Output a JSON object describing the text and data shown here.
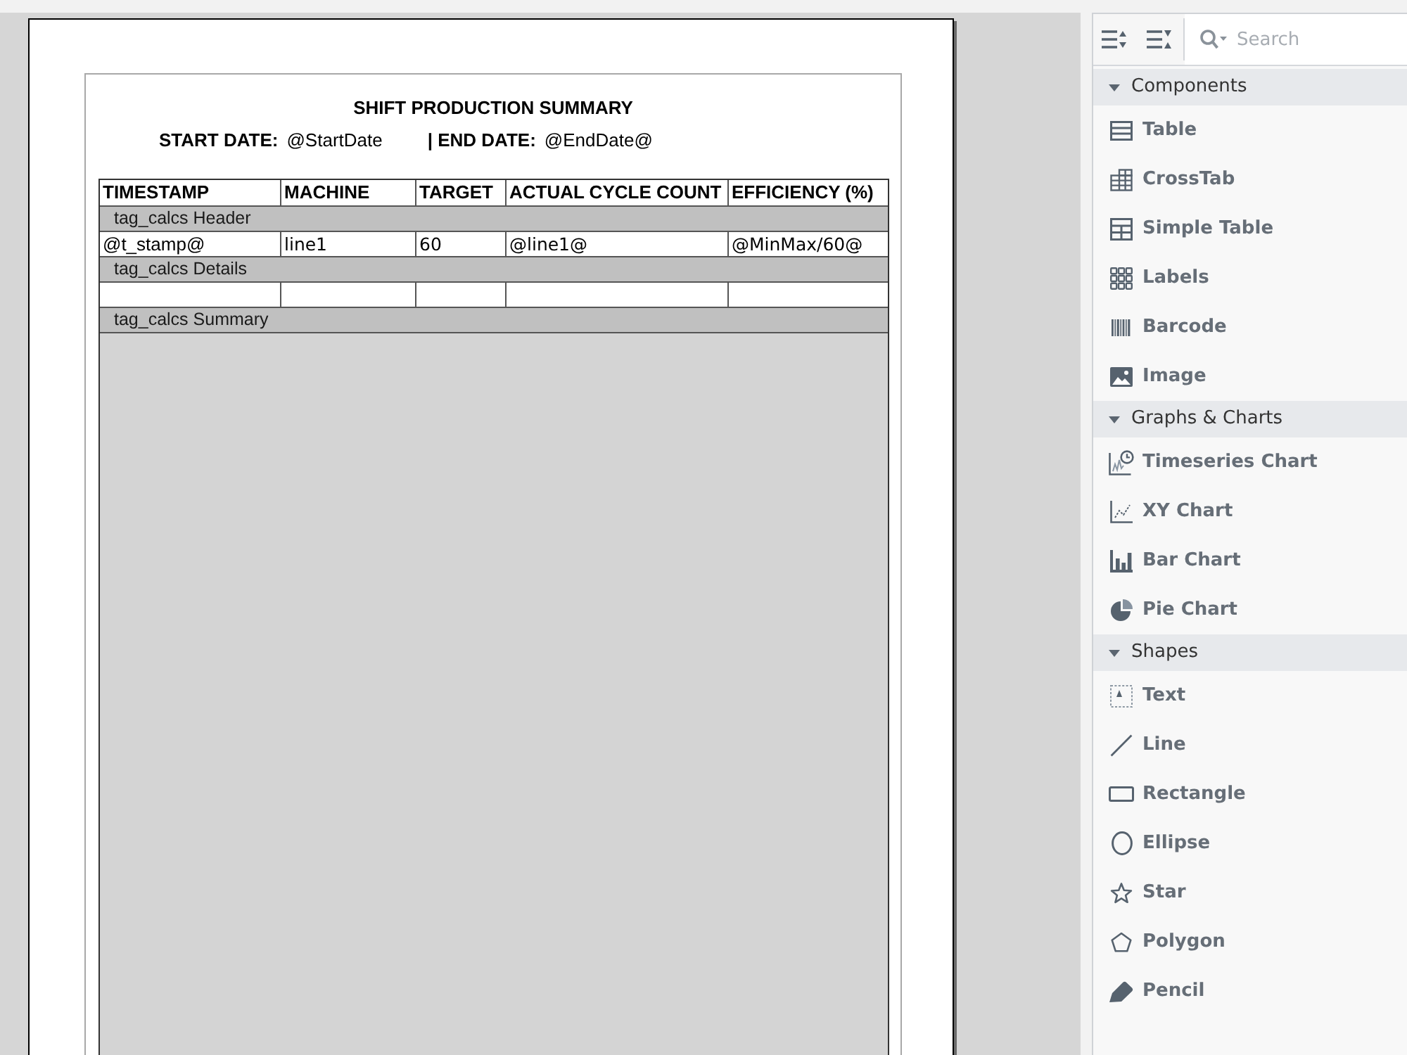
{
  "report": {
    "title": "SHIFT PRODUCTION SUMMARY",
    "parameters": [
      {
        "label": "START DATE:",
        "value": "@StartDate"
      },
      {
        "label": "| END DATE:",
        "value": "@EndDate@"
      }
    ],
    "table": {
      "columns": [
        "TIMESTAMP",
        "MACHINE",
        "TARGET",
        "ACTUAL CYCLE COUNT",
        "EFFICIENCY (%)"
      ],
      "rows": [
        {
          "kind": "band",
          "label": "tag_calcs Header"
        },
        {
          "kind": "fields",
          "cells": [
            "@t_stamp@",
            "line1",
            "60",
            "@line1@",
            "@MinMax/60@"
          ]
        },
        {
          "kind": "band",
          "label": "tag_calcs Details"
        },
        {
          "kind": "blank"
        },
        {
          "kind": "band",
          "label": "tag_calcs Summary"
        }
      ]
    }
  },
  "palette": {
    "search": {
      "placeholder": "Search"
    },
    "sections": [
      {
        "title": "Components",
        "expanded": true,
        "items": [
          {
            "label": "Table",
            "kind": "table"
          },
          {
            "label": "CrossTab",
            "kind": "crosstab"
          },
          {
            "label": "Simple Table",
            "kind": "simple_table"
          },
          {
            "label": "Labels",
            "kind": "labels"
          },
          {
            "label": "Barcode",
            "kind": "barcode"
          },
          {
            "label": "Image",
            "kind": "image"
          }
        ]
      },
      {
        "title": "Graphs & Charts",
        "expanded": true,
        "items": [
          {
            "label": "Timeseries Chart",
            "kind": "timeseries"
          },
          {
            "label": "XY Chart",
            "kind": "xy"
          },
          {
            "label": "Bar Chart",
            "kind": "bar"
          },
          {
            "label": "Pie Chart",
            "kind": "pie"
          }
        ]
      },
      {
        "title": "Shapes",
        "expanded": true,
        "items": [
          {
            "label": "Text",
            "kind": "text"
          },
          {
            "label": "Line",
            "kind": "line"
          },
          {
            "label": "Rectangle",
            "kind": "rectangle"
          },
          {
            "label": "Ellipse",
            "kind": "ellipse"
          },
          {
            "label": "Star",
            "kind": "star"
          },
          {
            "label": "Polygon",
            "kind": "polygon"
          },
          {
            "label": "Pencil",
            "kind": "pencil"
          }
        ]
      }
    ]
  }
}
